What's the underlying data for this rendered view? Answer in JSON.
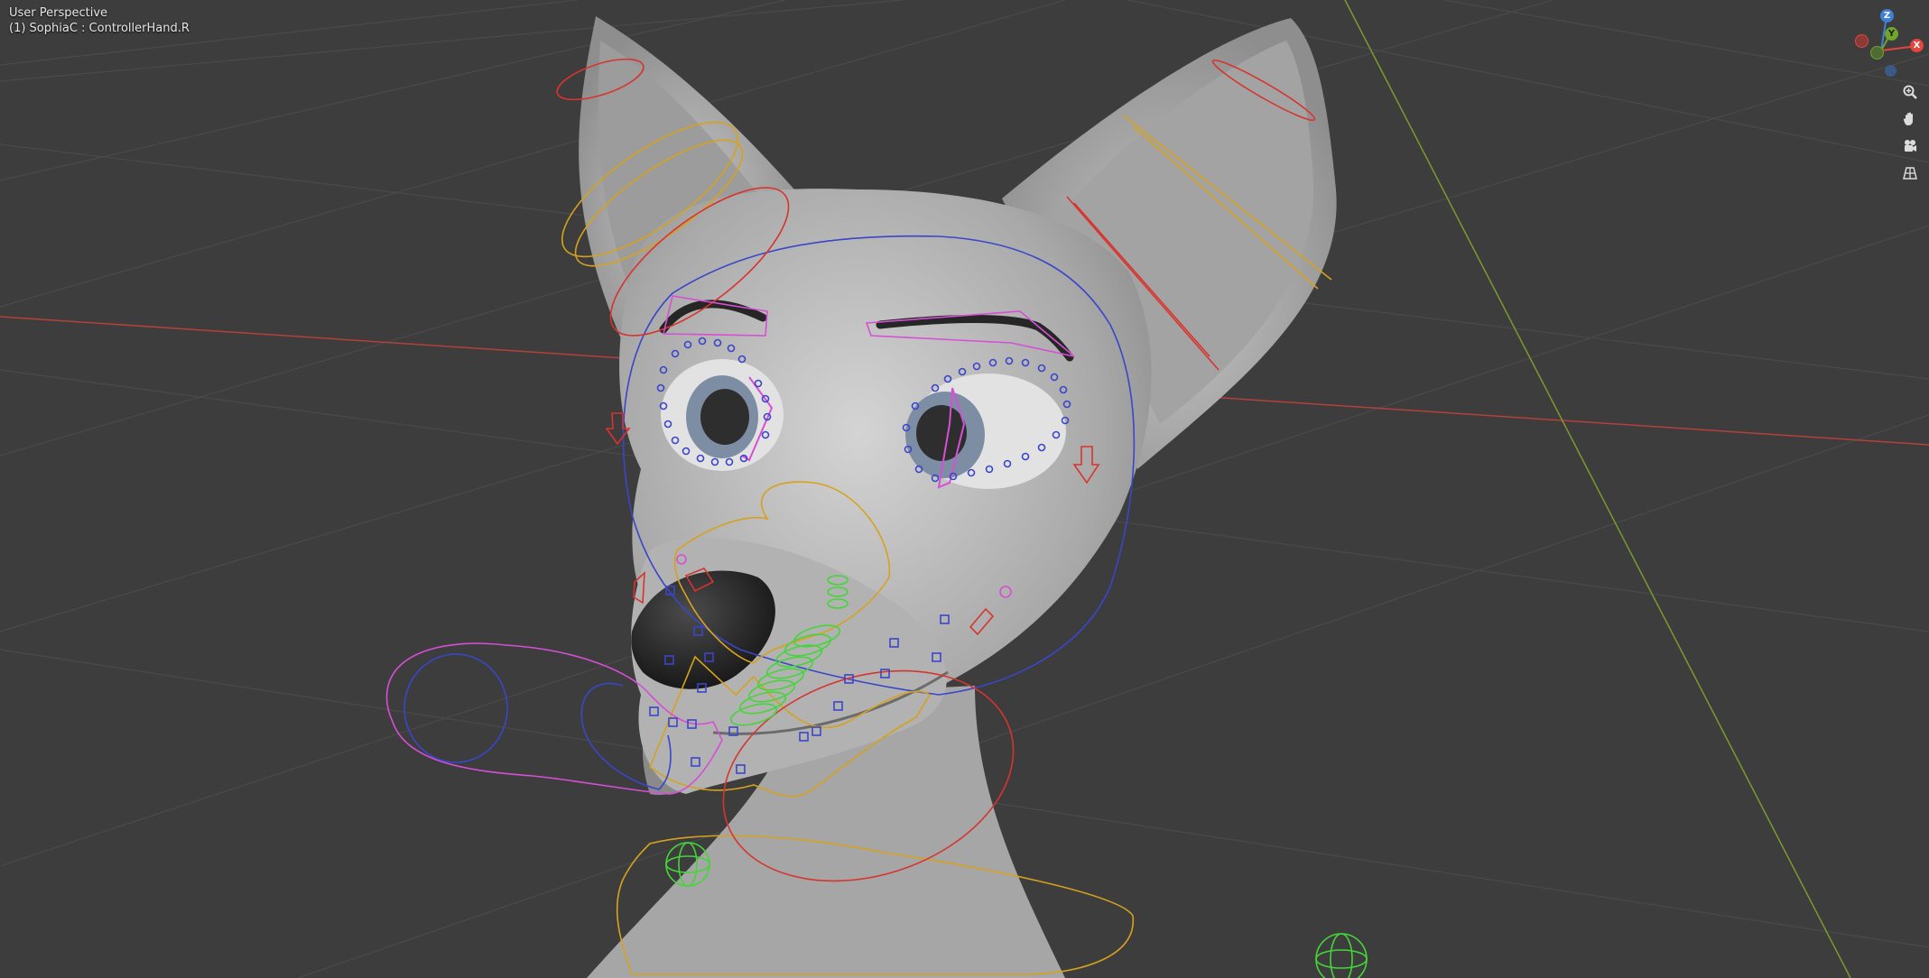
{
  "viewport": {
    "view_name": "User Perspective",
    "context": "(1) SophiaC : ControllerHand.R"
  },
  "gizmo": {
    "x_label": "X",
    "y_label": "Y",
    "z_label": "Z",
    "colors": {
      "x": "#e4453d",
      "y": "#6fa52b",
      "z": "#3f7fd6",
      "neg_x": "#8c3a37",
      "neg_y": "#4f6b33",
      "neg_z": "#3b5a86"
    }
  },
  "navigation_tools": [
    {
      "name": "zoom-icon"
    },
    {
      "name": "pan-hand-icon"
    },
    {
      "name": "camera-view-icon"
    },
    {
      "name": "toggle-perspective-grid-icon"
    }
  ],
  "colors": {
    "background": "#3d3d3d",
    "grid": "#4a4a4a",
    "x_axis_line": "#b3413d",
    "y_axis_line": "#7b9a2d",
    "mesh": "#b8b8b8",
    "bone_blue": "#3a46c8",
    "bone_red": "#d8342f",
    "bone_yellow": "#d6a21e",
    "bone_pink": "#d64fd6",
    "bone_green": "#45d53a"
  }
}
